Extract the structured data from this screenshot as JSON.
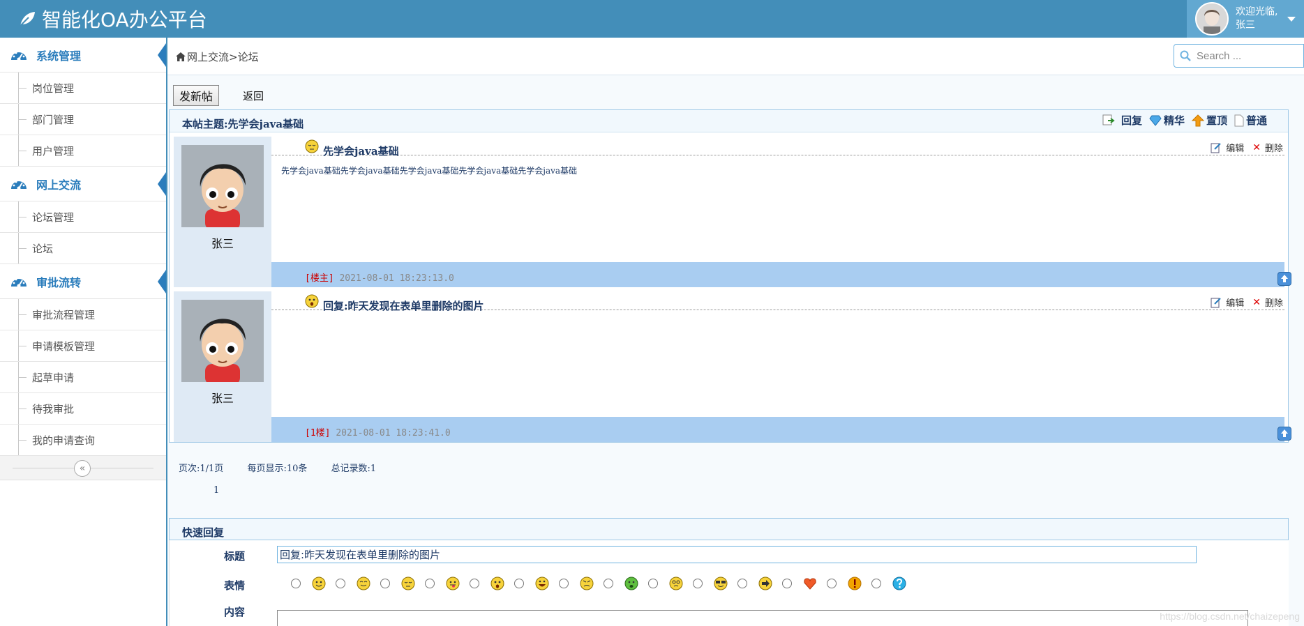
{
  "app": {
    "title": "智能化OA办公平台"
  },
  "user": {
    "welcome": "欢迎光临,",
    "name": "张三"
  },
  "sidebar": {
    "groups": [
      {
        "label": "系统管理",
        "items": [
          "岗位管理",
          "部门管理",
          "用户管理"
        ]
      },
      {
        "label": "网上交流",
        "items": [
          "论坛管理",
          "论坛"
        ]
      },
      {
        "label": "审批流转",
        "items": [
          "审批流程管理",
          "申请模板管理",
          "起草申请",
          "待我审批",
          "我的申请查询"
        ]
      }
    ]
  },
  "breadcrumb": {
    "path": "网上交流>论坛"
  },
  "search": {
    "placeholder": "Search ..."
  },
  "toolbar": {
    "new_post": "发新帖",
    "back": "返回"
  },
  "thread": {
    "title": "本帖主题:先学会java基础",
    "actions": {
      "reply": "回复",
      "elite": "精华",
      "top": "置顶",
      "normal": "普通"
    }
  },
  "posts": [
    {
      "author": "张三",
      "title": "先学会java基础",
      "content": "先学会java基础先学会java基础先学会java基础先学会java基础先学会java基础",
      "floor": "[楼主]",
      "time": "2021-08-01 18:23:13.0",
      "edit": "编辑",
      "delete": "删除"
    },
    {
      "author": "张三",
      "title": "回复:昨天发现在表单里删除的图片",
      "content": "",
      "floor": "[1楼]",
      "time": "2021-08-01 18:23:41.0",
      "edit": "编辑",
      "delete": "删除"
    }
  ],
  "pager": {
    "pages": "页次:1/1页",
    "per_page": "每页显示:10条",
    "total": "总记录数:1",
    "current": "1"
  },
  "quick_reply": {
    "heading": "快速回复",
    "title_label": "标题",
    "title_value": "回复:昨天发现在表单里删除的图片",
    "emotion_label": "表情",
    "content_label": "内容",
    "emotions": [
      "smile-icon",
      "grin-icon",
      "sleepy-icon",
      "tongue-icon",
      "surprised-icon",
      "laugh-icon",
      "angry-icon",
      "sick-icon",
      "dizzy-icon",
      "cool-icon",
      "arrow-right-icon",
      "heart-icon",
      "warning-icon",
      "question-icon"
    ]
  },
  "watermark": "https://blog.csdn.net/chaizepeng",
  "colors": {
    "header": "#438eb9",
    "accent": "#2b7dbc",
    "post_footer": "#a9cdf1"
  }
}
